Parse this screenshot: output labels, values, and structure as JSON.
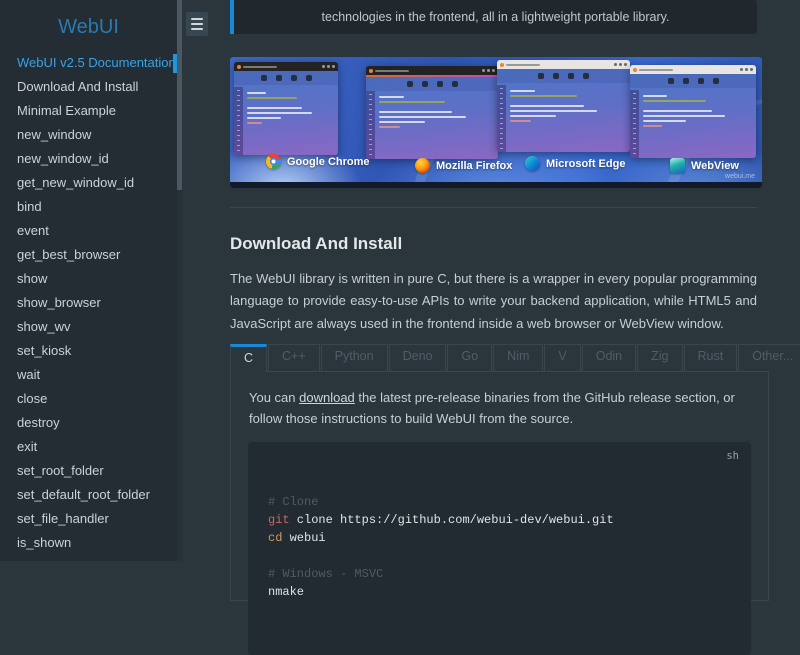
{
  "colors": {
    "accent_blue": "#1789d6",
    "active_link_blue": "#36a3e9",
    "sidebar_title_blue": "#2a7ab0",
    "page_background": "#2b353c",
    "sidebar_background": "#232d33",
    "code_background": "#222b31",
    "code_red": "#cc6666",
    "code_orange": "#d19a66",
    "code_comment_gray": "#4f5b63"
  },
  "topbar": {
    "menu_icon": "hamburger-icon"
  },
  "sidebar": {
    "title": "WebUI",
    "items": [
      {
        "label": "WebUI v2.5 Documentation",
        "active": true
      },
      {
        "label": "Download And Install",
        "active": false
      },
      {
        "label": "Minimal Example",
        "active": false
      },
      {
        "label": "new_window",
        "active": false
      },
      {
        "label": "new_window_id",
        "active": false
      },
      {
        "label": "get_new_window_id",
        "active": false
      },
      {
        "label": "bind",
        "active": false
      },
      {
        "label": "event",
        "active": false
      },
      {
        "label": "get_best_browser",
        "active": false
      },
      {
        "label": "show",
        "active": false
      },
      {
        "label": "show_browser",
        "active": false
      },
      {
        "label": "show_wv",
        "active": false
      },
      {
        "label": "set_kiosk",
        "active": false
      },
      {
        "label": "wait",
        "active": false
      },
      {
        "label": "close",
        "active": false
      },
      {
        "label": "destroy",
        "active": false
      },
      {
        "label": "exit",
        "active": false
      },
      {
        "label": "set_root_folder",
        "active": false
      },
      {
        "label": "set_default_root_folder",
        "active": false
      },
      {
        "label": "set_file_handler",
        "active": false
      },
      {
        "label": "is_shown",
        "active": false
      }
    ]
  },
  "intro": {
    "text": "technologies in the frontend, all in a lightweight portable library."
  },
  "hero": {
    "browsers": [
      {
        "name": "Google Chrome",
        "icon": "chrome-icon"
      },
      {
        "name": "Mozilla Firefox",
        "icon": "firefox-icon"
      },
      {
        "name": "Microsoft Edge",
        "icon": "edge-icon"
      },
      {
        "name": "WebView",
        "icon": "webview-icon"
      }
    ],
    "watermark": "webui.me"
  },
  "section": {
    "heading": "Download And Install",
    "paragraph": "The WebUI library is written in pure C, but there is a wrapper in every popular programming language to provide easy-to-use APIs to write your backend application, while HTML5 and JavaScript are always used in the frontend inside a web browser or WebView window."
  },
  "tabs": [
    {
      "label": "C",
      "active": true
    },
    {
      "label": "C++",
      "active": false
    },
    {
      "label": "Python",
      "active": false
    },
    {
      "label": "Deno",
      "active": false
    },
    {
      "label": "Go",
      "active": false
    },
    {
      "label": "Nim",
      "active": false
    },
    {
      "label": "V",
      "active": false
    },
    {
      "label": "Odin",
      "active": false
    },
    {
      "label": "Zig",
      "active": false
    },
    {
      "label": "Rust",
      "active": false
    },
    {
      "label": "Other...",
      "active": false
    }
  ],
  "tab_panel": {
    "text_before": "You can ",
    "link_text": "download",
    "text_after": " the latest pre-release binaries from the GitHub release section, or follow those instructions to build WebUI from the source.",
    "code": {
      "language": "sh",
      "lines": [
        [
          {
            "text": "# Clone",
            "type": "comment"
          }
        ],
        [
          {
            "text": "git",
            "type": "red"
          },
          {
            "text": " clone https://github.com/webui-dev/webui.git",
            "type": "plain"
          }
        ],
        [
          {
            "text": "cd",
            "type": "orange"
          },
          {
            "text": " webui",
            "type": "plain"
          }
        ],
        [],
        [
          {
            "text": "# Windows - MSVC",
            "type": "comment"
          }
        ],
        [
          {
            "text": "nmake",
            "type": "plain"
          }
        ]
      ]
    }
  }
}
